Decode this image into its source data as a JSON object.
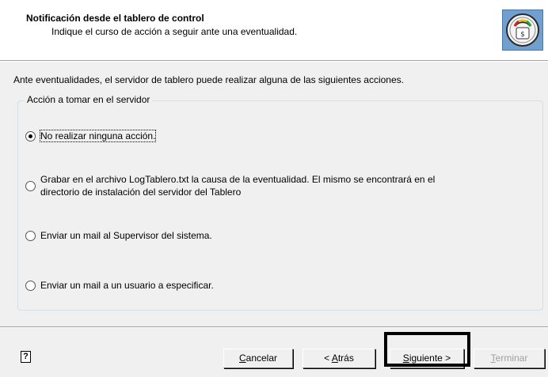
{
  "header": {
    "title": "Notificación desde el tablero de control",
    "subtitle": "Indique el curso de acción a seguir ante una eventualidad.",
    "logo_icon": "dashboard-gauge-icon"
  },
  "intro_text": "Ante eventualidades, el servidor de tablero puede realizar alguna de las siguientes acciones.",
  "group": {
    "legend": "Acción a tomar en el servidor",
    "options": [
      {
        "label": "No realizar ninguna acción.",
        "checked": true
      },
      {
        "label_line1": "Grabar en el archivo LogTablero.txt la causa de la eventualidad. El mismo se encontrará en el",
        "label_line2": "directorio de instalación del servidor del Tablero",
        "checked": false
      },
      {
        "label": "Enviar un mail al Supervisor del sistema.",
        "checked": false
      },
      {
        "label": "Enviar un mail a un usuario a especificar.",
        "checked": false
      }
    ]
  },
  "footer": {
    "help_icon": "?",
    "cancel": {
      "accel": "C",
      "rest": "ancelar"
    },
    "back": {
      "pre": "< ",
      "accel": "A",
      "rest": "trás"
    },
    "next": {
      "accel": "S",
      "rest": "iguiente >"
    },
    "finish": {
      "accel": "T",
      "rest": "erminar"
    }
  }
}
